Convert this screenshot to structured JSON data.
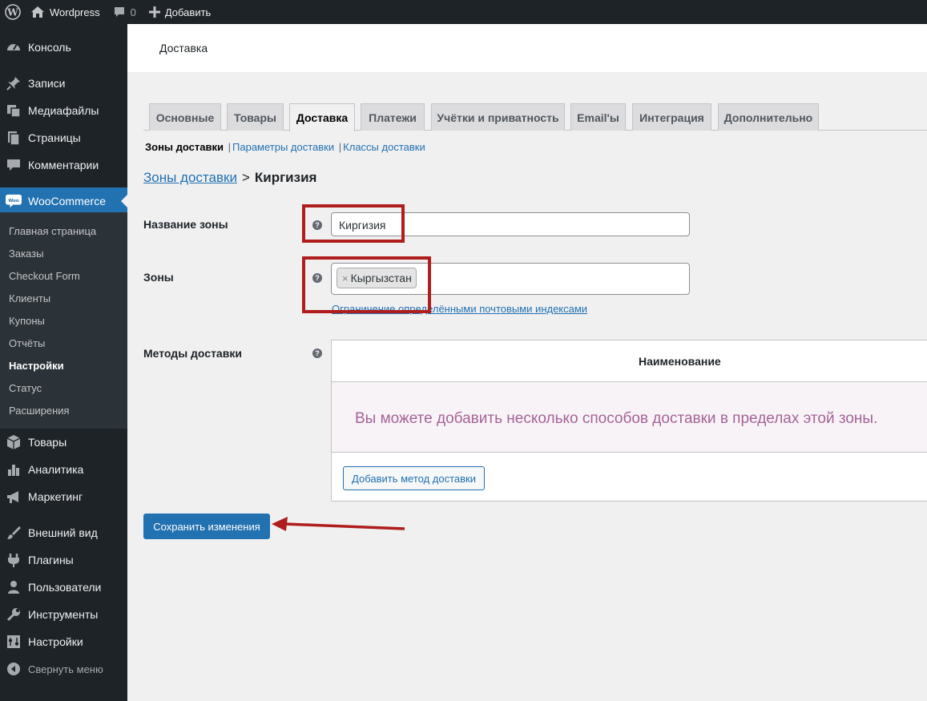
{
  "admin_bar": {
    "site_name": "Wordpress",
    "comments_count": "0",
    "add_new": "Добавить"
  },
  "sidebar": {
    "items_top": [
      {
        "label": "Консоль",
        "icon": "dashboard-icon"
      },
      {
        "label": "Записи",
        "icon": "pin-icon"
      },
      {
        "label": "Медиафайлы",
        "icon": "media-icon"
      },
      {
        "label": "Страницы",
        "icon": "pages-icon"
      },
      {
        "label": "Комментарии",
        "icon": "comment-icon"
      }
    ],
    "woocommerce": {
      "label": "WooCommerce",
      "icon": "woo-icon",
      "badge": "Woo"
    },
    "submenu": [
      "Главная страница",
      "Заказы",
      "Checkout Form",
      "Клиенты",
      "Купоны",
      "Отчёты",
      "Настройки",
      "Статус",
      "Расширения"
    ],
    "items_bottom": [
      {
        "label": "Товары",
        "icon": "box-icon"
      },
      {
        "label": "Аналитика",
        "icon": "bar-chart-icon"
      },
      {
        "label": "Маркетинг",
        "icon": "megaphone-icon"
      },
      {
        "label": "Внешний вид",
        "icon": "brush-icon"
      },
      {
        "label": "Плагины",
        "icon": "plug-icon"
      },
      {
        "label": "Пользователи",
        "icon": "user-icon"
      },
      {
        "label": "Инструменты",
        "icon": "wrench-icon"
      },
      {
        "label": "Настройки",
        "icon": "settings-icon"
      }
    ],
    "collapse": "Свернуть меню"
  },
  "page": {
    "title": "Доставка"
  },
  "tabs": [
    "Основные",
    "Товары",
    "Доставка",
    "Платежи",
    "Учётки и приватность",
    "Email'ы",
    "Интеграция",
    "Дополнительно"
  ],
  "subsub": {
    "current": "Зоны доставки",
    "links": [
      "Параметры доставки",
      "Классы доставки"
    ]
  },
  "breadcrumb": {
    "link": "Зоны доставки",
    "separator": ">",
    "current": "Киргизия"
  },
  "form": {
    "zone_name_label": "Название зоны",
    "zone_name_value": "Киргизия",
    "regions_label": "Зоны",
    "region_chip": "Кыргызстан",
    "postcode_link": "Ограничение определёнными почтовыми индексами",
    "methods_label": "Методы доставки",
    "methods_column": "Наименование",
    "methods_empty": "Вы можете добавить несколько способов доставки в пределах этой зоны.",
    "add_method_button": "Добавить метод доставки",
    "save_button": "Сохранить изменения",
    "help_glyph": "?"
  },
  "colors": {
    "accent": "#2271b1",
    "annotation": "#b01d1d",
    "woo_message": "#a46497"
  }
}
